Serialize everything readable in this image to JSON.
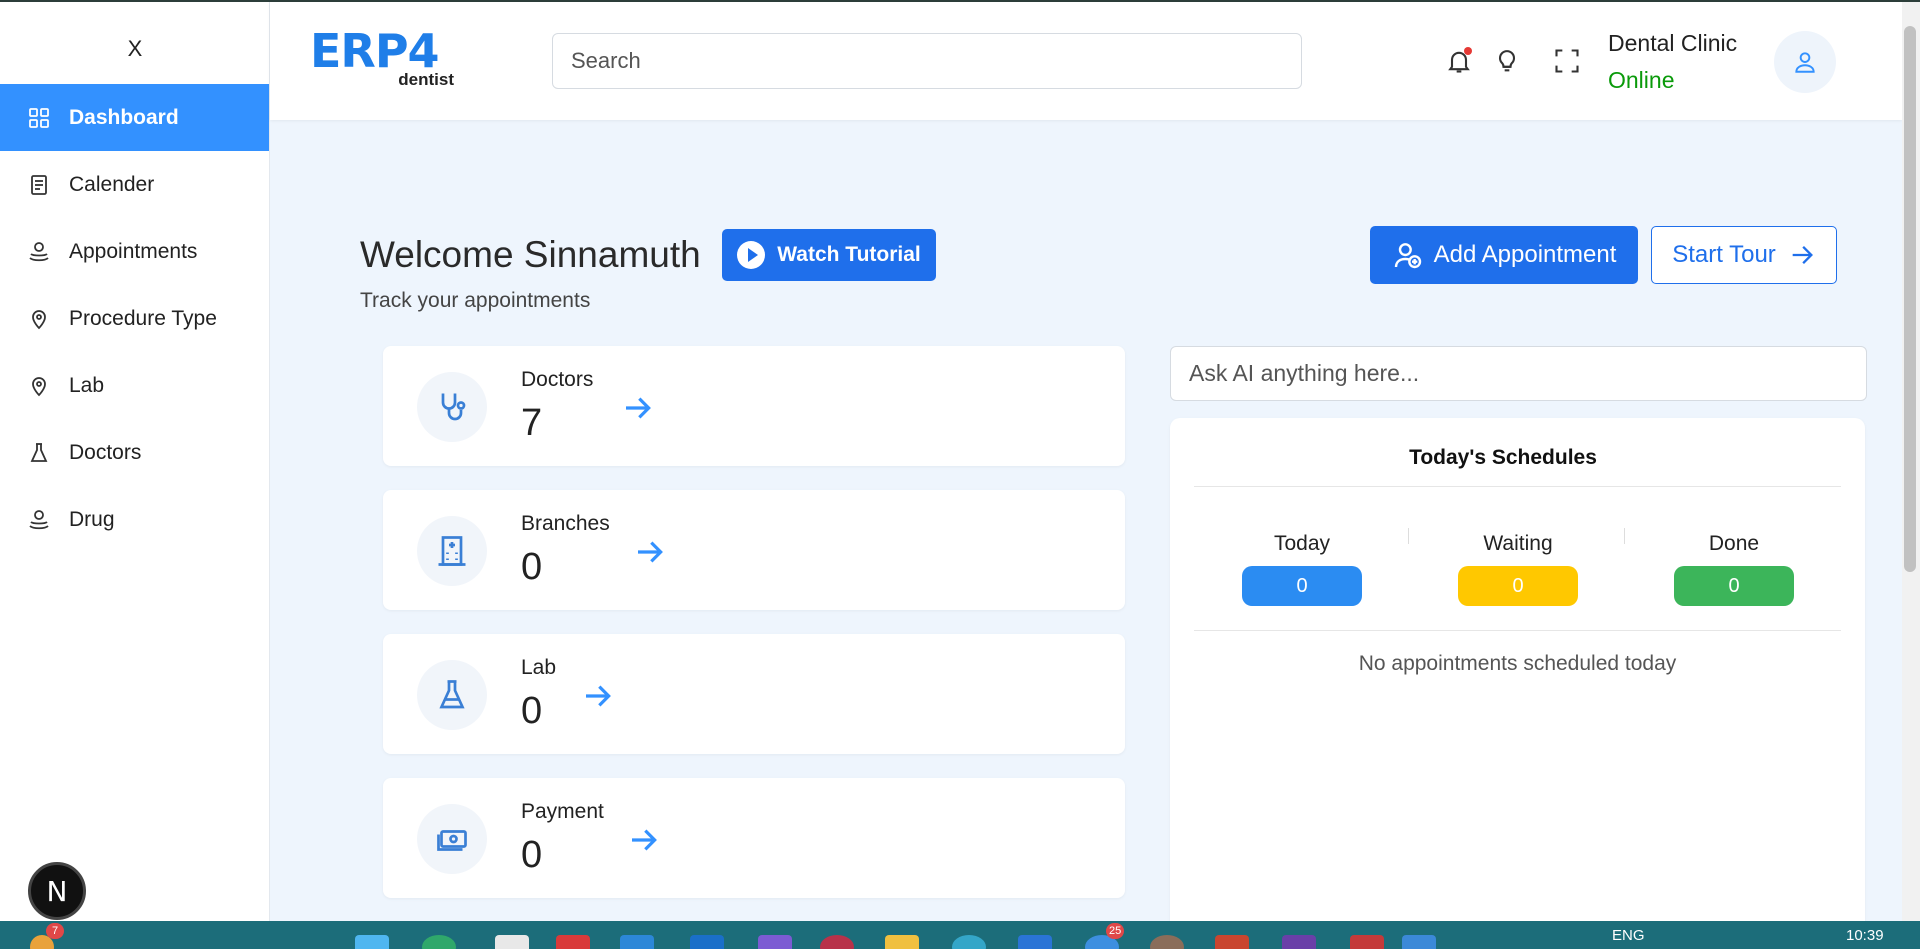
{
  "sidebar": {
    "close_label": "X",
    "items": [
      {
        "label": "Dashboard",
        "icon": "grid-icon",
        "active": true
      },
      {
        "label": "Calender",
        "icon": "calendar-icon"
      },
      {
        "label": "Appointments",
        "icon": "appointment-icon"
      },
      {
        "label": "Procedure Type",
        "icon": "pin-icon"
      },
      {
        "label": "Lab",
        "icon": "pin-icon"
      },
      {
        "label": "Doctors",
        "icon": "flask-icon"
      },
      {
        "label": "Drug",
        "icon": "drug-icon"
      }
    ]
  },
  "header": {
    "logo_main": "ERP4",
    "logo_sub": "dentist",
    "search_placeholder": "Search",
    "clinic_name": "Dental Clinic",
    "status": "Online",
    "status_color": "#0a9a0a"
  },
  "main": {
    "welcome": "Welcome Sinnamuth",
    "subtitle": "Track your appointments",
    "watch_tutorial": "Watch Tutorial",
    "add_appointment": "Add Appointment",
    "start_tour": "Start Tour",
    "cards": [
      {
        "title": "Doctors",
        "value": "7",
        "icon": "stethoscope-icon"
      },
      {
        "title": "Branches",
        "value": "0",
        "icon": "building-icon"
      },
      {
        "title": "Lab",
        "value": "0",
        "icon": "flask-icon"
      },
      {
        "title": "Payment",
        "value": "0",
        "icon": "money-icon"
      }
    ],
    "ai_placeholder": "Ask AI anything here...",
    "schedules": {
      "title": "Today's Schedules",
      "today_label": "Today",
      "today_value": "0",
      "waiting_label": "Waiting",
      "waiting_value": "0",
      "done_label": "Done",
      "done_value": "0",
      "empty_message": "No appointments scheduled today"
    }
  },
  "colors": {
    "accent": "#3391ff",
    "primary_button": "#1f6feb",
    "today": "#2b8cf2",
    "waiting": "#ffc800",
    "done": "#3cb55a"
  },
  "bubble_label": "N",
  "taskbar": {
    "start_badge": "7",
    "mail_badge": "25",
    "lang": "ENG",
    "time": "10:39"
  }
}
